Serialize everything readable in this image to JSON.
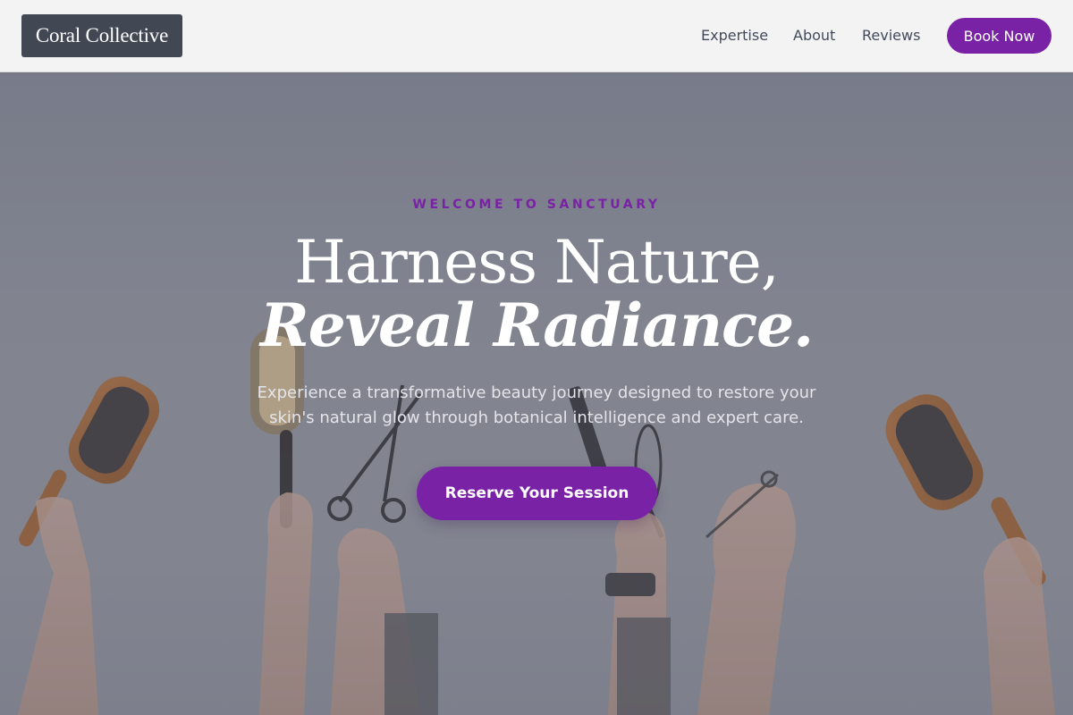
{
  "header": {
    "logo": "Coral Collective",
    "nav": {
      "expertise": "Expertise",
      "about": "About",
      "reviews": "Reviews"
    },
    "book_button": "Book Now"
  },
  "hero": {
    "eyebrow": "WELCOME TO SANCTUARY",
    "headline_line1": "Harness Nature,",
    "headline_line2": "Reveal Radiance.",
    "subtitle": "Experience a transformative beauty journey designed to restore your skin's natural glow through botanical intelligence and expert care.",
    "cta_button": "Reserve Your Session",
    "background_image": "hands holding hairbrushes, scissors and a whisk against a wall"
  },
  "colors": {
    "accent": "#7a22a6",
    "logo_bg": "#424754",
    "header_bg": "#f3f3f4",
    "nav_text": "#444a5a"
  }
}
